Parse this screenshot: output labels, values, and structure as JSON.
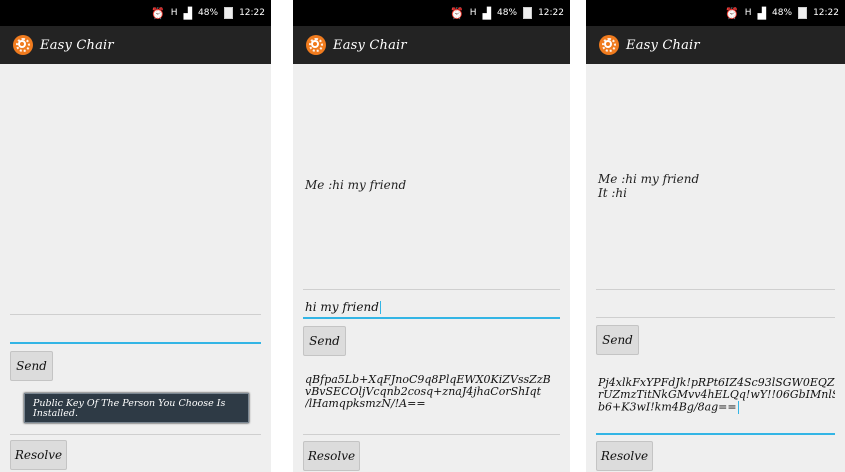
{
  "status": {
    "time": "12:22",
    "battery": "48%",
    "signal": "H"
  },
  "app": {
    "title": "Easy Chair"
  },
  "buttons": {
    "send": "Send",
    "resolve": "Resolve"
  },
  "screens": [
    {
      "messages": [],
      "input": "",
      "key_lines": [],
      "toast": "Public Key Of The Person You Choose Is Installed."
    },
    {
      "messages": [
        "Me :hi my friend"
      ],
      "input": "hi my friend",
      "key_lines": [
        "qBfpa5Lb+XqFJnoC9q8PlqEWX0KiZVssZzB",
        "vBvSECOljVcqnb2cosq+znaJ4jhaCorShIqt",
        "/lHamqpksmzN/!A=="
      ]
    },
    {
      "messages": [
        "Me :hi my friend",
        "It :hi"
      ],
      "input": "",
      "key_lines": [
        "Pj4xlkFxYPFdJk!pRPt6IZ4Sc93lSGW0EQZ",
        "rUZmzTitNkGMvv4hELQq!wY!!06GbIMnlS",
        "b6+K3wI!km4Bg/8ag=="
      ]
    }
  ]
}
